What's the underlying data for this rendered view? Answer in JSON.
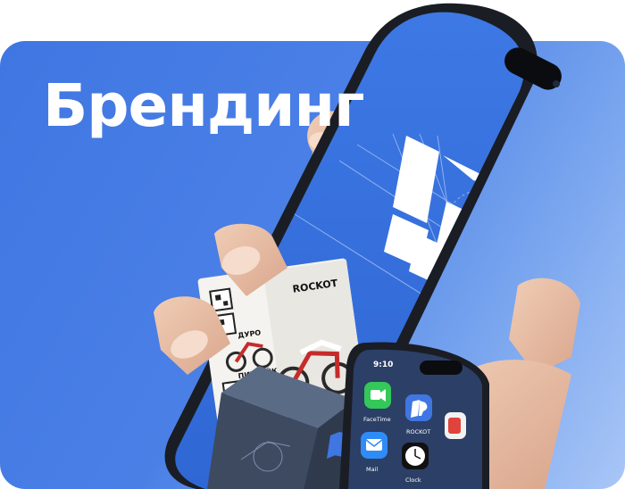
{
  "banner": {
    "title": "Брендинг",
    "background_color": "#3f76e2"
  },
  "brand": {
    "name": "ROCKOT",
    "logo_icon": "rockot-r-logo-icon"
  },
  "flyer": {
    "brand_label": "ROCKOT",
    "side_label_1": "ДУРО",
    "side_label_2": "ПИТБАЙК"
  },
  "small_phone": {
    "time": "9:10",
    "apps": [
      {
        "name": "FaceTime",
        "icon": "video-camera-icon",
        "color": "#34c759"
      },
      {
        "name": "ROCKOT",
        "icon": "rockot-r-logo-icon",
        "color": "#3f76e2"
      },
      {
        "name": "Mail",
        "icon": "envelope-icon",
        "color": "#2f8cf7"
      },
      {
        "name": "Clock",
        "icon": "clock-icon",
        "color": "#111111"
      }
    ]
  }
}
